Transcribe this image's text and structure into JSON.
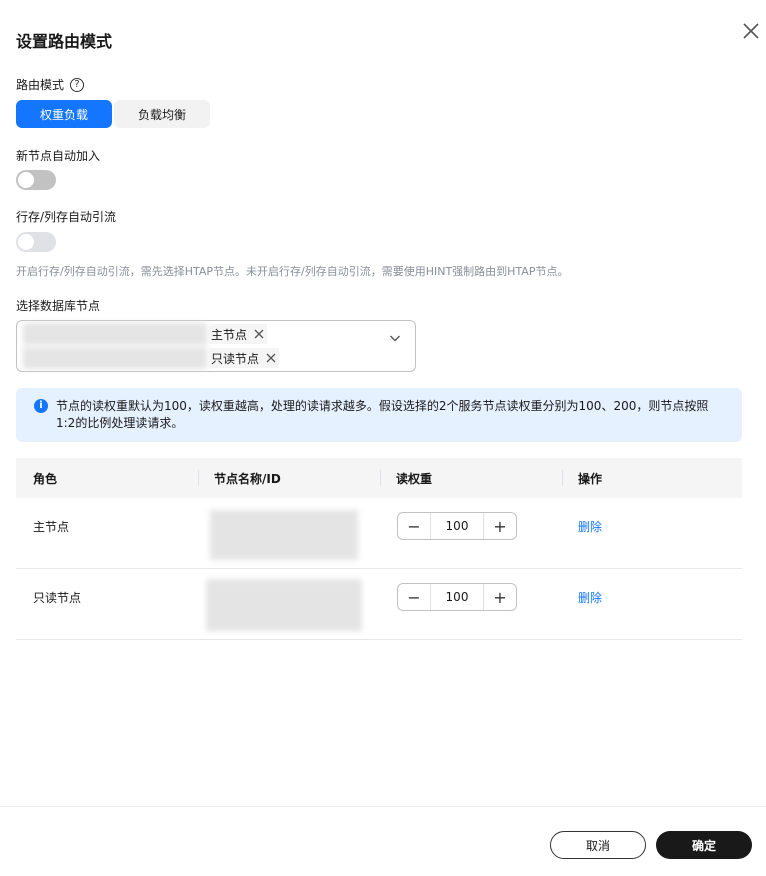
{
  "dialog": {
    "title": "设置路由模式"
  },
  "route_mode": {
    "label": "路由模式",
    "help_glyph": "?",
    "options": [
      "权重负载",
      "负载均衡"
    ],
    "selected": "权重负载"
  },
  "auto_join": {
    "label": "新节点自动加入",
    "enabled": false
  },
  "htap_route": {
    "label": "行存/列存自动引流",
    "enabled": false,
    "hint": "开启行存/列存自动引流，需先选择HTAP节点。未开启行存/列存自动引流，需要使用HINT强制路由到HTAP节点。"
  },
  "db_nodes": {
    "label": "选择数据库节点",
    "tags": [
      "主节点",
      "只读节点"
    ]
  },
  "info": {
    "icon_glyph": "i",
    "text": "节点的读权重默认为100，读权重越高，处理的读请求越多。假设选择的2个服务节点读权重分别为100、200，则节点按照1:2的比例处理读请求。"
  },
  "table": {
    "columns": [
      "角色",
      "节点名称/ID",
      "读权重",
      "操作"
    ],
    "rows": [
      {
        "role": "主节点",
        "weight": "100",
        "action": "删除"
      },
      {
        "role": "只读节点",
        "weight": "100",
        "action": "删除"
      }
    ],
    "minus_glyph": "−",
    "plus_glyph": "+"
  },
  "footer": {
    "cancel_label": "取消",
    "ok_label": "确定"
  },
  "colors": {
    "accent": "#1476ff",
    "primary_button": "#191919",
    "toggle_off": "#c2c2c2",
    "info_bg": "#e6f1ff"
  },
  "icons": {
    "close": "close-icon",
    "help": "question-circle-icon",
    "chevron": "chevron-down-icon",
    "tag_remove": "close-icon",
    "info": "info-icon"
  }
}
